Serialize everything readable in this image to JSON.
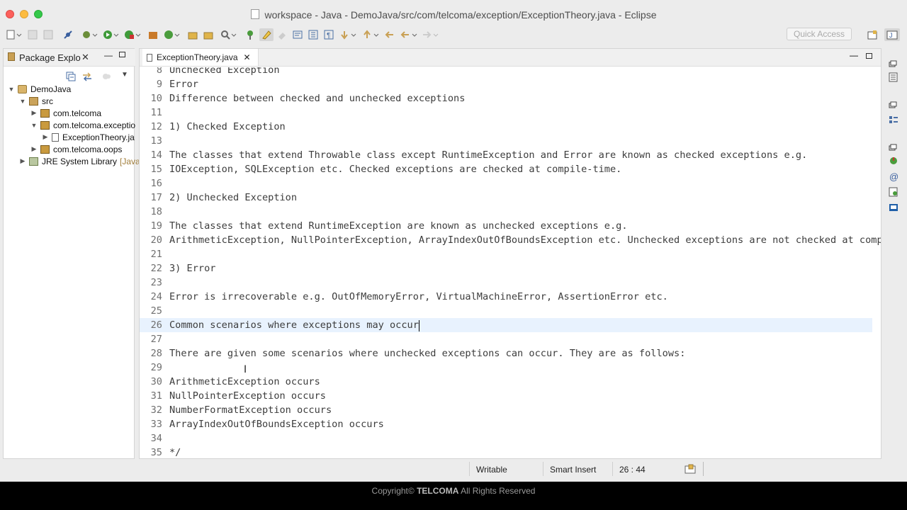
{
  "window": {
    "title": "workspace - Java - DemoJava/src/com/telcoma/exception/ExceptionTheory.java - Eclipse"
  },
  "toolbar": {
    "quick_access_placeholder": "Quick Access"
  },
  "package_explorer": {
    "tab_label": "Package Explo",
    "tree": [
      {
        "label": "DemoJava",
        "icon": "project-icon",
        "expanded": true
      },
      {
        "label": "src",
        "icon": "source-folder-icon",
        "expanded": true
      },
      {
        "label": "com.telcoma",
        "icon": "package-icon",
        "expanded": false
      },
      {
        "label": "com.telcoma.exceptio",
        "icon": "package-icon",
        "expanded": true
      },
      {
        "label": "ExceptionTheory.ja",
        "icon": "java-file-icon",
        "expanded": false
      },
      {
        "label": "com.telcoma.oops",
        "icon": "package-icon",
        "expanded": false
      },
      {
        "label": "JRE System Library",
        "decoration": "[Java",
        "icon": "library-icon",
        "expanded": false
      }
    ]
  },
  "editor": {
    "tab_label": "ExceptionTheory.java",
    "lines": [
      {
        "n": "8",
        "text": "Unchecked Exception"
      },
      {
        "n": "9",
        "text": "Error"
      },
      {
        "n": "10",
        "text": "Difference between checked and unchecked exceptions"
      },
      {
        "n": "11",
        "text": ""
      },
      {
        "n": "12",
        "text": "1) Checked Exception"
      },
      {
        "n": "13",
        "text": ""
      },
      {
        "n": "14",
        "text": "The classes that extend Throwable class except RuntimeException and Error are known as checked exceptions e.g."
      },
      {
        "n": "15",
        "text": "IOException, SQLException etc. Checked exceptions are checked at compile-time."
      },
      {
        "n": "16",
        "text": ""
      },
      {
        "n": "17",
        "text": "2) Unchecked Exception"
      },
      {
        "n": "18",
        "text": ""
      },
      {
        "n": "19",
        "text": "The classes that extend RuntimeException are known as unchecked exceptions e.g."
      },
      {
        "n": "20",
        "text": "ArithmeticException, NullPointerException, ArrayIndexOutOfBoundsException etc. Unchecked exceptions are not checked at compi"
      },
      {
        "n": "21",
        "text": ""
      },
      {
        "n": "22",
        "text": "3) Error"
      },
      {
        "n": "23",
        "text": ""
      },
      {
        "n": "24",
        "text": "Error is irrecoverable e.g. OutOfMemoryError, VirtualMachineError, AssertionError etc."
      },
      {
        "n": "25",
        "text": ""
      },
      {
        "n": "26",
        "text": "Common scenarios where exceptions may occur"
      },
      {
        "n": "27",
        "text": ""
      },
      {
        "n": "28",
        "text": "There are given some scenarios where unchecked exceptions can occur. They are as follows:"
      },
      {
        "n": "29",
        "text": ""
      },
      {
        "n": "30",
        "text": "ArithmeticException occurs"
      },
      {
        "n": "31",
        "text": "NullPointerException occurs"
      },
      {
        "n": "32",
        "text": "NumberFormatException occurs"
      },
      {
        "n": "33",
        "text": "ArrayIndexOutOfBoundsException occurs"
      },
      {
        "n": "34",
        "text": ""
      },
      {
        "n": "35",
        "text": "*/"
      }
    ]
  },
  "status_bar": {
    "writable": "Writable",
    "insert_mode": "Smart Insert",
    "position": "26 : 44"
  },
  "footer": {
    "prefix": "Copyright©",
    "brand": "TELCOMA",
    "suffix": "All Rights Reserved"
  }
}
